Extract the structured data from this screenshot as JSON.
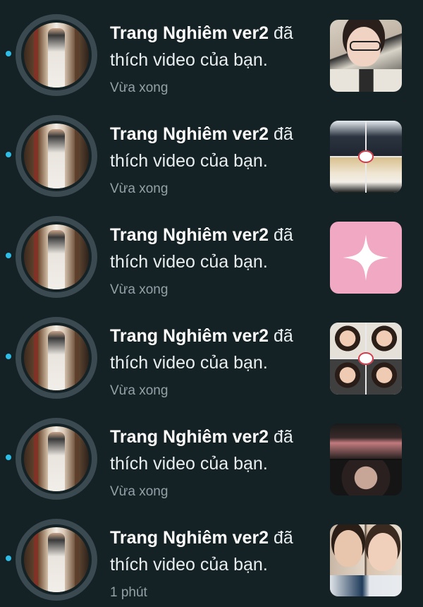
{
  "notifications": [
    {
      "username": "Trang Nghiêm ver2",
      "action": "đã thích video của bạn.",
      "time": "Vừa xong",
      "thumbnail": "selfie-glasses"
    },
    {
      "username": "Trang Nghiêm ver2",
      "action": "đã thích video của bạn.",
      "time": "Vừa xong",
      "thumbnail": "collage-4"
    },
    {
      "username": "Trang Nghiêm ver2",
      "action": "đã thích video của bạn.",
      "time": "Vừa xong",
      "thumbnail": "pink-sparkle"
    },
    {
      "username": "Trang Nghiêm ver2",
      "action": "đã thích video của bạn.",
      "time": "Vừa xong",
      "thumbnail": "collage-faces"
    },
    {
      "username": "Trang Nghiêm ver2",
      "action": "đã thích video của bạn.",
      "time": "Vừa xong",
      "thumbnail": "dim-photos"
    },
    {
      "username": "Trang Nghiêm ver2",
      "action": "đã thích video của bạn.",
      "time": "1 phút",
      "thumbnail": "two-students"
    }
  ],
  "colors": {
    "background": "#142125",
    "unread_dot": "#2dbde6",
    "text_primary": "#e9eef0",
    "text_secondary": "#94a1a6"
  }
}
